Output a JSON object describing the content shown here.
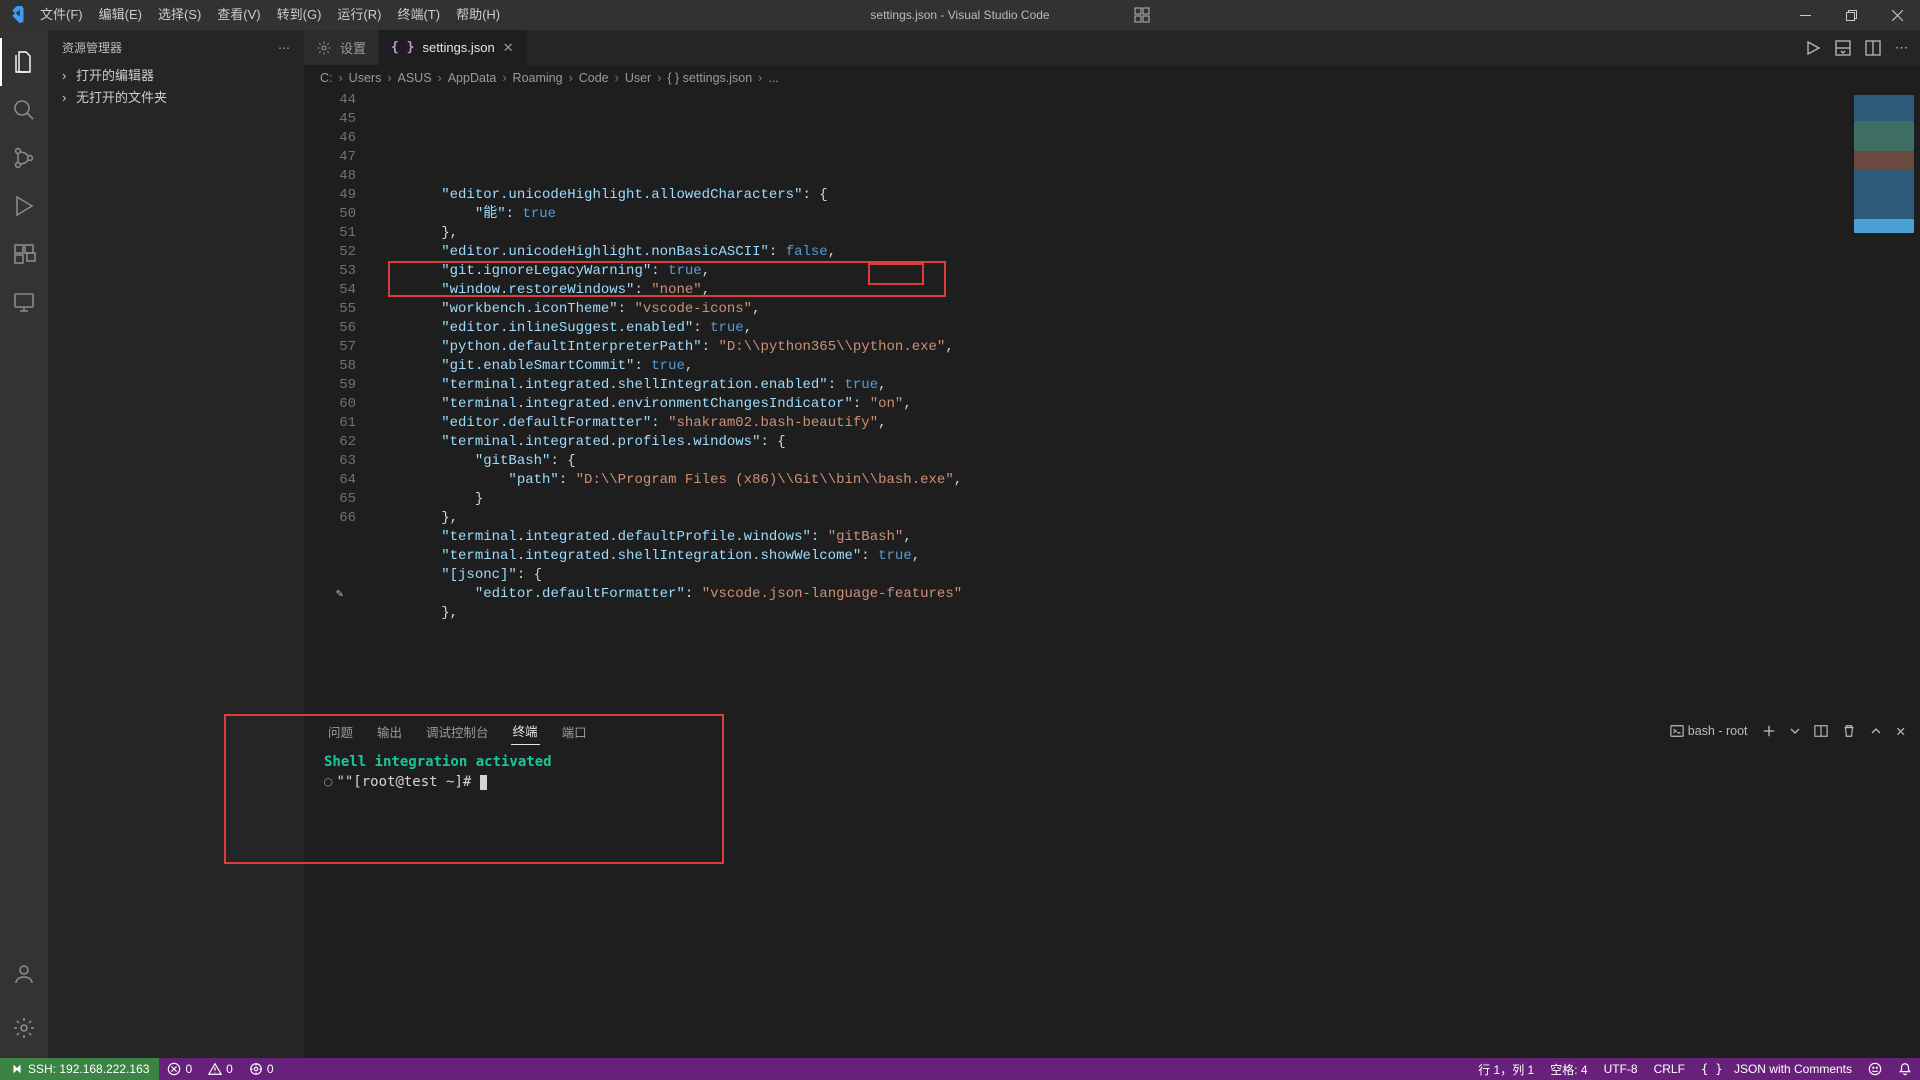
{
  "title": "settings.json - Visual Studio Code",
  "menu": [
    "文件(F)",
    "编辑(E)",
    "选择(S)",
    "查看(V)",
    "转到(G)",
    "运行(R)",
    "终端(T)",
    "帮助(H)"
  ],
  "sidebar": {
    "title": "资源管理器",
    "sections": [
      "打开的编辑器",
      "无打开的文件夹"
    ]
  },
  "tabs": [
    {
      "label": "设置",
      "kind": "gear"
    },
    {
      "label": "settings.json",
      "kind": "json",
      "active": true
    }
  ],
  "breadcrumbs": [
    "C:",
    "Users",
    "ASUS",
    "AppData",
    "Roaming",
    "Code",
    "User",
    "{ } settings.json",
    "..."
  ],
  "lines": [
    {
      "n": 44,
      "indent": 2,
      "k": "\"editor.unicodeHighlight.allowedCharacters\"",
      "v": "{",
      "vt": "punc",
      "sep": ": "
    },
    {
      "n": 45,
      "indent": 3,
      "k": "\"能\"",
      "v": "true",
      "vt": "bool"
    },
    {
      "n": 46,
      "indent": 2,
      "raw": "},"
    },
    {
      "n": 47,
      "indent": 2,
      "k": "\"editor.unicodeHighlight.nonBasicASCII\"",
      "v": "false",
      "vt": "bool",
      "comma": true
    },
    {
      "n": 48,
      "indent": 2,
      "k": "\"git.ignoreLegacyWarning\"",
      "v": "true",
      "vt": "bool",
      "comma": true
    },
    {
      "n": 49,
      "indent": 2,
      "k": "\"window.restoreWindows\"",
      "v": "\"none\"",
      "vt": "str",
      "comma": true
    },
    {
      "n": 50,
      "indent": 2,
      "k": "\"workbench.iconTheme\"",
      "v": "\"vscode-icons\"",
      "vt": "str",
      "comma": true
    },
    {
      "n": 51,
      "indent": 2,
      "k": "\"editor.inlineSuggest.enabled\"",
      "v": "true",
      "vt": "bool",
      "comma": true
    },
    {
      "n": 52,
      "indent": 2,
      "k": "\"python.defaultInterpreterPath\"",
      "v": "\"D:\\\\python365\\\\python.exe\"",
      "vt": "str",
      "comma": true
    },
    {
      "n": 53,
      "indent": 2,
      "k": "\"git.enableSmartCommit\"",
      "v": "true",
      "vt": "bool",
      "comma": true
    },
    {
      "n": 54,
      "indent": 2,
      "k": "\"terminal.integrated.shellIntegration.enabled\"",
      "v": "true",
      "vt": "bool",
      "comma": true
    },
    {
      "n": 55,
      "indent": 2,
      "k": "\"terminal.integrated.environmentChangesIndicator\"",
      "v": "\"on\"",
      "vt": "str",
      "comma": true
    },
    {
      "n": 56,
      "indent": 2,
      "k": "\"editor.defaultFormatter\"",
      "v": "\"shakram02.bash-beautify\"",
      "vt": "str",
      "comma": true
    },
    {
      "n": 57,
      "indent": 2,
      "k": "\"terminal.integrated.profiles.windows\"",
      "v": "{",
      "vt": "punc",
      "sep": ": "
    },
    {
      "n": 58,
      "indent": 3,
      "k": "\"gitBash\"",
      "v": "{",
      "vt": "punc",
      "sep": ": "
    },
    {
      "n": 59,
      "indent": 4,
      "k": "\"path\"",
      "v": "\"D:\\\\Program Files (x86)\\\\Git\\\\bin\\\\bash.exe\"",
      "vt": "str",
      "comma": true
    },
    {
      "n": 60,
      "indent": 3,
      "raw": "}"
    },
    {
      "n": 61,
      "indent": 2,
      "raw": "},"
    },
    {
      "n": 62,
      "indent": 2,
      "k": "\"terminal.integrated.defaultProfile.windows\"",
      "v": "\"gitBash\"",
      "vt": "str",
      "comma": true
    },
    {
      "n": 63,
      "indent": 2,
      "k": "\"terminal.integrated.shellIntegration.showWelcome\"",
      "v": "true",
      "vt": "bool",
      "comma": true
    },
    {
      "n": 64,
      "indent": 2,
      "k": "\"[jsonc]\"",
      "v": "{",
      "vt": "punc",
      "sep": ": "
    },
    {
      "n": 65,
      "indent": 3,
      "k": "\"editor.defaultFormatter\"",
      "v": "\"vscode.json-language-features\"",
      "vt": "str"
    },
    {
      "n": 66,
      "indent": 2,
      "raw": "},"
    }
  ],
  "panel": {
    "tabs": [
      "问题",
      "输出",
      "调试控制台",
      "终端",
      "端口"
    ],
    "activeTab": "终端",
    "terminalName": "bash - root",
    "activated": "Shell integration activated",
    "prompt": "\"\"[root@test ~]# "
  },
  "status": {
    "remote": "SSH: 192.168.222.163",
    "errors": "0",
    "warnings": "0",
    "ports": "0",
    "lncol": "行 1，列 1",
    "spaces": "空格: 4",
    "encoding": "UTF-8",
    "eol": "CRLF",
    "lang": "JSON with Comments"
  }
}
